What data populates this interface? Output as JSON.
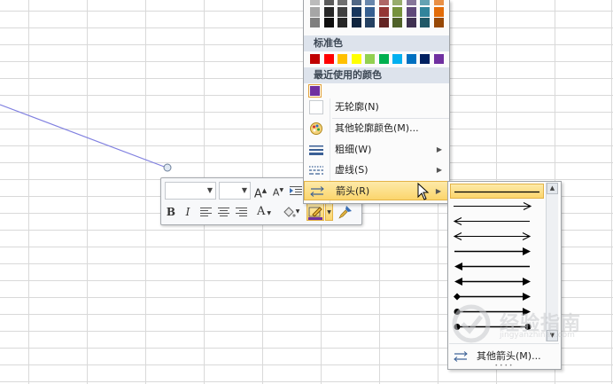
{
  "colors": {
    "theme_rows": [
      [
        "#a6a6a6",
        "#262626",
        "#404040",
        "#17365d",
        "#365f91",
        "#943634",
        "#76923c",
        "#5f497a",
        "#31849b",
        "#e36c09"
      ],
      [
        "#7f7f7f",
        "#0d0d0d",
        "#262626",
        "#0f243e",
        "#244061",
        "#632423",
        "#4f6128",
        "#3f3151",
        "#205867",
        "#974806"
      ]
    ],
    "standard": [
      "#c00000",
      "#ff0000",
      "#ffc000",
      "#ffff00",
      "#92d050",
      "#00b050",
      "#00b0f0",
      "#0070c0",
      "#002060",
      "#7030a0"
    ],
    "recent": "#7030a0",
    "shape_line": "#8080e0",
    "highlight_top": "#fdeaa8",
    "highlight_bottom": "#fbd56c"
  },
  "menu": {
    "standard_header": "标准色",
    "recent_header": "最近使用的颜色",
    "items": [
      {
        "label": "无轮廓(N)",
        "icon": "no-outline-icon",
        "submenu": false
      },
      {
        "label": "其他轮廓颜色(M)...",
        "icon": "color-palette-icon",
        "submenu": false
      },
      {
        "label": "粗细(W)",
        "icon": "line-weight-icon",
        "submenu": true
      },
      {
        "label": "虚线(S)",
        "icon": "dash-style-icon",
        "submenu": true
      },
      {
        "label": "箭头(R)",
        "icon": "arrow-style-icon",
        "submenu": true
      }
    ]
  },
  "mini_toolbar": {
    "font_name": "",
    "font_size": "",
    "grow_label": "A",
    "shrink_label": "A",
    "bold_label": "B",
    "italic_label": "I",
    "font_color_label": "A"
  },
  "arrow_styles": {
    "options": [
      "plain",
      "arrow-right",
      "arrow-left",
      "arrow-both",
      "triangle-right",
      "triangle-left",
      "triangle-both",
      "diamond-left",
      "dot-left",
      "dot-both"
    ],
    "selected": "plain",
    "more_label": "其他箭头(M)..."
  },
  "watermark": {
    "text": "经验指南",
    "sub": "jingyanzhinan.com"
  }
}
